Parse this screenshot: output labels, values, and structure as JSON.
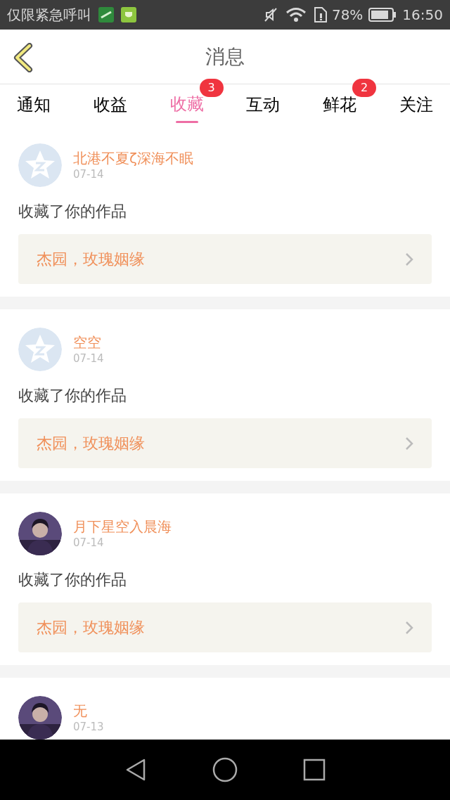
{
  "status_bar": {
    "carrier": "仅限紧急呼叫",
    "battery": "78%",
    "time": "16:50"
  },
  "header": {
    "title": "消息"
  },
  "tabs": [
    {
      "label": "通知",
      "selected": false
    },
    {
      "label": "收益",
      "selected": false
    },
    {
      "label": "收藏",
      "selected": true,
      "badge": "3"
    },
    {
      "label": "互动",
      "selected": false
    },
    {
      "label": "鲜花",
      "selected": false,
      "badge": "2"
    },
    {
      "label": "关注",
      "selected": false
    }
  ],
  "messages": [
    {
      "avatar": {
        "kind": "default"
      },
      "name": "北港不夏ζ深海不眠",
      "date": "07-14",
      "text": "收藏了你的作品",
      "work": "杰园，玫瑰姻缘"
    },
    {
      "avatar": {
        "kind": "default"
      },
      "name": "空空",
      "date": "07-14",
      "text": "收藏了你的作品",
      "work": "杰园，玫瑰姻缘"
    },
    {
      "name": "月下星空入晨海",
      "date": "07-14",
      "text": "收藏了你的作品",
      "work": "杰园，玫瑰姻缘"
    },
    {
      "name": "无",
      "date": "07-13"
    }
  ]
}
